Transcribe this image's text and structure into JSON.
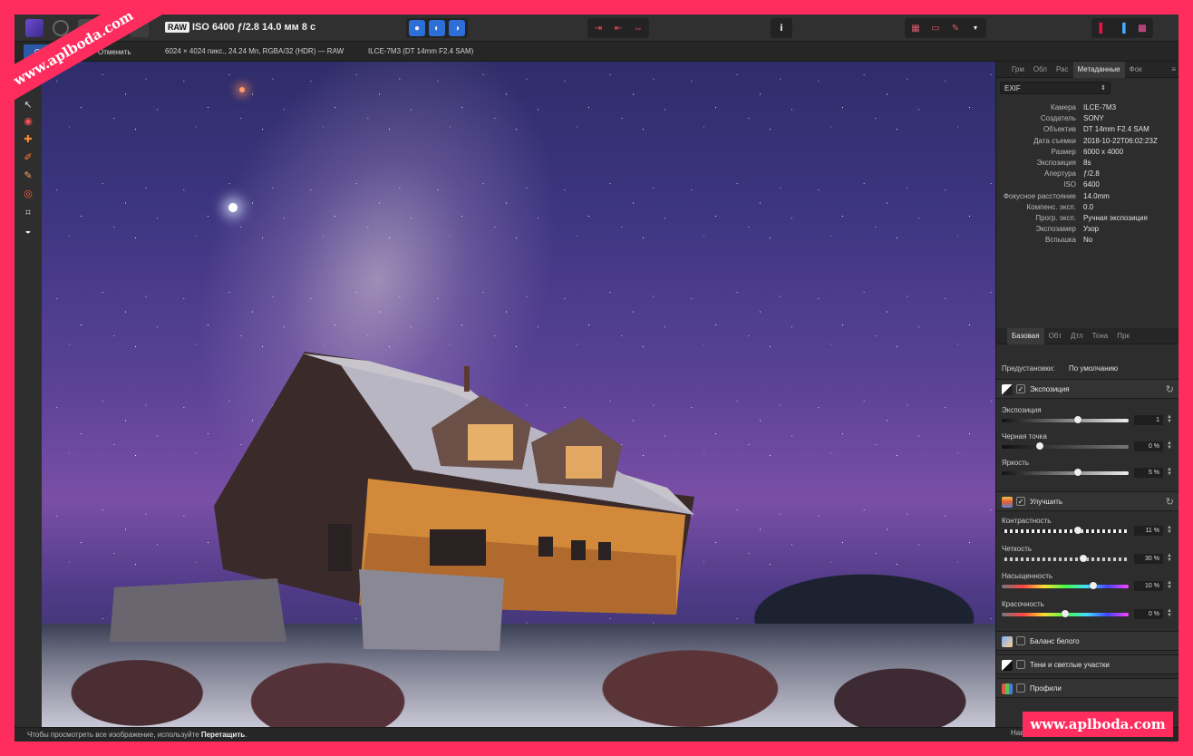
{
  "toolbar": {
    "raw_badge": "RAW",
    "photo_info": "ISO 6400 ƒ/2.8 14.0 мм 8 с"
  },
  "context_bar": {
    "apply_label": "Обр",
    "cancel_label": "Отменить",
    "image_info": "6024 × 4024 пикс., 24.24 Мп, RGBA/32 (HDR) — RAW",
    "lens_info": "ILCE-7M3 (DT 14mm F2.4 SAM)"
  },
  "panel_tabs": [
    "Грм",
    "Обл",
    "Рас",
    "Метаданные",
    "Фок"
  ],
  "panel_active_tab": "Метаданные",
  "exif": {
    "selected": "EXIF",
    "rows": [
      {
        "key": "Камера",
        "value": "ILCE-7M3"
      },
      {
        "key": "Создатель",
        "value": "SONY"
      },
      {
        "key": "Объектив",
        "value": "DT 14mm F2.4 SAM"
      },
      {
        "key": "Дата съемки",
        "value": "2018-10-22T06:02:23Z"
      },
      {
        "key": "Размер",
        "value": "6000 x 4000"
      },
      {
        "key": "Экспозиция",
        "value": "8s"
      },
      {
        "key": "Апертура",
        "value": "ƒ/2.8"
      },
      {
        "key": "ISO",
        "value": "6400"
      },
      {
        "key": "Фокусное расстояние",
        "value": "14.0mm"
      },
      {
        "key": "Компенс. эксп.",
        "value": "0.0"
      },
      {
        "key": "Прогр. эксп.",
        "value": "Ручная экспозиция"
      },
      {
        "key": "Экспозамер",
        "value": "Узор"
      },
      {
        "key": "Вспышка",
        "value": "No"
      }
    ]
  },
  "develop_tabs": [
    "Базовая",
    "Обт",
    "Дтл",
    "Тона",
    "Прк"
  ],
  "develop_active_tab": "Базовая",
  "presets": {
    "label": "Предустановки:",
    "value": "По умолчанию"
  },
  "sections": {
    "exposure": {
      "title": "Экспозиция",
      "sliders": [
        {
          "label": "Экспозиция",
          "value": "1",
          "position": 0.6
        },
        {
          "label": "Черная точка",
          "value": "0 %",
          "position": 0.3
        },
        {
          "label": "Яркость",
          "value": "5 %",
          "position": 0.6
        }
      ]
    },
    "enhance": {
      "title": "Улучшить",
      "sliders": [
        {
          "label": "Контрастность",
          "value": "11 %",
          "position": 0.6
        },
        {
          "label": "Четкость",
          "value": "30 %",
          "position": 0.64
        },
        {
          "label": "Насыщенность",
          "value": "10 %",
          "position": 0.72
        },
        {
          "label": "Красочность",
          "value": "0 %",
          "position": 0.5
        }
      ]
    },
    "white_balance": {
      "title": "Баланс белого"
    },
    "shadows": {
      "title": "Тени и светлые участки"
    },
    "profiles": {
      "title": "Профили"
    }
  },
  "status": {
    "text": "Чтобы просмотреть все изображение, используйте ",
    "bold": "Перетащить",
    "end": "."
  },
  "nav_footer": "Нав",
  "watermark": "www.aplboda.com",
  "colors": {
    "accent_blue": "#2c5aa8",
    "frame": "#ff2d5e",
    "panel_bg": "#2d2d2d"
  }
}
